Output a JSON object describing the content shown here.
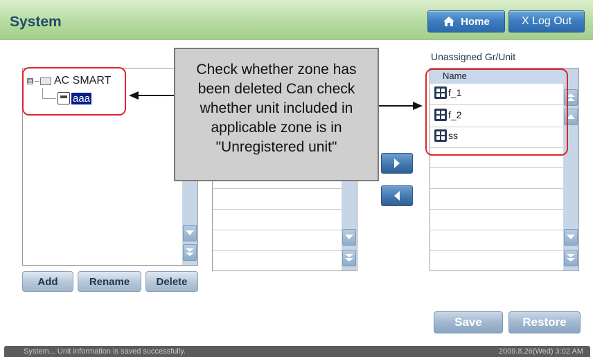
{
  "header": {
    "title": "System",
    "home_label": "Home",
    "logout_label": "X Log Out"
  },
  "tree": {
    "root_label": "AC SMART",
    "child_label": "aaa",
    "expander": "⊟"
  },
  "left_actions": {
    "add": "Add",
    "rename": "Rename",
    "delete": "Delete"
  },
  "unassigned": {
    "heading": "Unassigned Gr/Unit",
    "column_header": "Name",
    "items": [
      "f_1",
      "f_2",
      "ss"
    ]
  },
  "callout": {
    "text": "Check whether zone has been deleted Can check whether unit included in applicable zone is in \"Unregistered unit\""
  },
  "bottom_actions": {
    "save": "Save",
    "restore": "Restore"
  },
  "status": {
    "message": "System... Unit information is saved successfully.",
    "datetime": "2009.8.26(Wed)  3:02 AM"
  },
  "colors": {
    "accent_green": "#b6dba0",
    "title_text": "#244a6b",
    "highlight_red": "#e0242c",
    "selection": "#0a1f8a"
  }
}
